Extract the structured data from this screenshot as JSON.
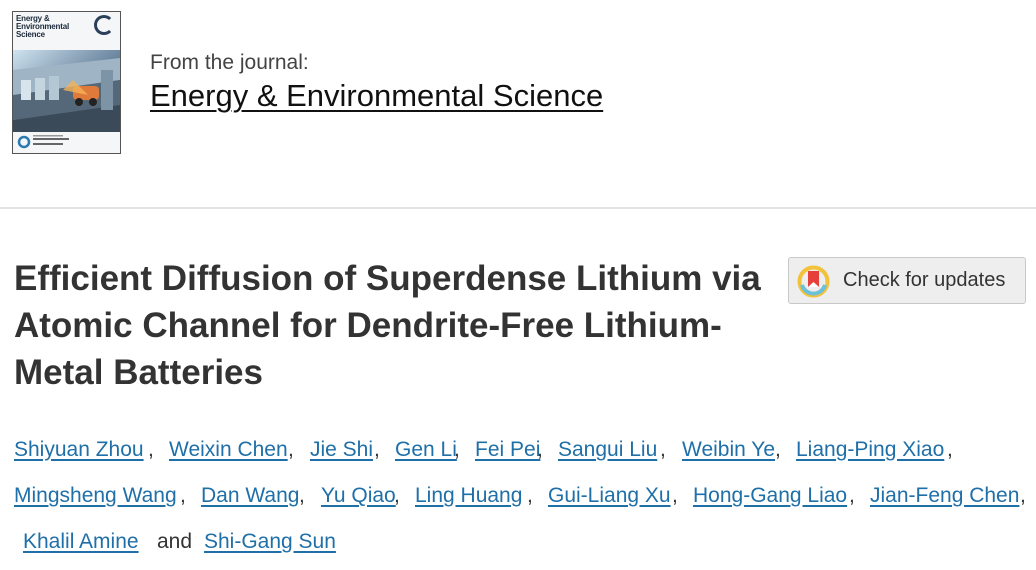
{
  "journal": {
    "cover": {
      "title": "Energy & Environmental Science",
      "icon": "journal-cover-image"
    },
    "from_label": "From the journal:",
    "name": "Energy & Environmental Science"
  },
  "article": {
    "title": "Efficient Diffusion of Superdense Lithium via Atomic Channel for Dendrite-Free Lithium-Metal Batteries",
    "check_updates": {
      "label": "Check for updates",
      "icon": "crossmark-icon"
    }
  },
  "authors": [
    {
      "name": "Shiyuan Zhou",
      "sep": ","
    },
    {
      "name": "Weixin Chen",
      "sep": ","
    },
    {
      "name": "Jie Shi",
      "sep": ","
    },
    {
      "name": "Gen Li",
      "sep": ","
    },
    {
      "name": "Fei Pei",
      "sep": ","
    },
    {
      "name": "Sangui Liu",
      "sep": ","
    },
    {
      "name": "Weibin Ye",
      "sep": ","
    },
    {
      "name": "Liang-Ping Xiao",
      "sep": ","
    },
    {
      "name": "Mingsheng Wang",
      "sep": ","
    },
    {
      "name": "Dan Wang",
      "sep": ","
    },
    {
      "name": "Yu Qiao",
      "sep": ","
    },
    {
      "name": "Ling Huang",
      "sep": ","
    },
    {
      "name": "Gui-Liang Xu",
      "sep": ","
    },
    {
      "name": "Hong-Gang Liao",
      "sep": ","
    },
    {
      "name": "Jian-Feng Chen",
      "sep": ","
    },
    {
      "name": "Khalil Amine",
      "sep": "and"
    },
    {
      "name": "Shi-Gang Sun",
      "sep": ""
    }
  ],
  "colors": {
    "author_link": "#1f6fa8",
    "title_text": "#333333",
    "divider": "#e3e3e3"
  }
}
